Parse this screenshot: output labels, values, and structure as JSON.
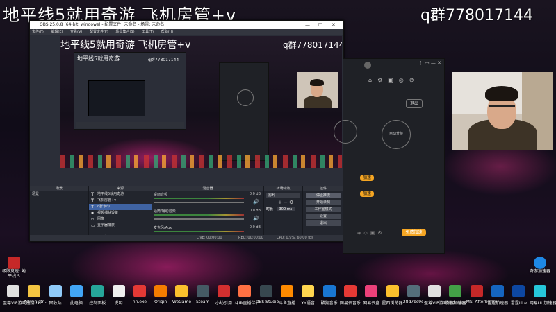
{
  "overlay": {
    "title": "地平线5就用奇游   飞机房管+v",
    "qq": "q群778017144"
  },
  "obs": {
    "window_title": "OBS 25.0.8 (64-bit, windows) - 配置文件: 未命名 - 场景: 未命名",
    "menu": [
      "文件(F)",
      "编辑(E)",
      "查看(V)",
      "配置文件(P)",
      "场景集合(S)",
      "工具(T)",
      "帮助(H)"
    ],
    "preview_title": "地平线5就用奇游   飞机房管+v",
    "preview_qq": "q群778017144",
    "nested_qq": "q群778017144",
    "nested_title": "地平线5就用奇游",
    "docks": {
      "scenes_header": "场景",
      "scene_item": "场景",
      "sources_header": "来源",
      "sources": [
        {
          "label": "地平线5就用奇游",
          "selected": false
        },
        {
          "label": "飞机房管+v",
          "selected": false
        },
        {
          "label": "q群水印",
          "selected": true
        },
        {
          "label": "视频捕获设备",
          "selected": false
        },
        {
          "label": "图像",
          "selected": false
        },
        {
          "label": "显示器捕获",
          "selected": false
        }
      ],
      "mixer_header": "混音器",
      "mixer": [
        {
          "label": "桌面音频",
          "db": "0.0 dB"
        },
        {
          "label": "话筒/辅助音频",
          "db": "0.0 dB"
        },
        {
          "label": "麦克风/Aux",
          "db": "0.0 dB"
        }
      ],
      "transitions_header": "转场特效",
      "transition_value": "淡出",
      "duration_label": "时长",
      "duration_value": "300 ms",
      "controls_header": "控件",
      "controls": [
        "停止推流",
        "开始录制",
        "工作室模式",
        "设置",
        "退出"
      ]
    },
    "status": {
      "live": "LIVE: 00:00:00",
      "rec": "REC: 00:00:00",
      "cpu": "CPU: 0.9%, 60.00 fps"
    }
  },
  "qiyou": {
    "btn_exit": "退出",
    "auto_upgrade": "自动升级",
    "btn_speed": "加速",
    "btn_speed2": "加速",
    "btn_main": "免费加速"
  },
  "desktop_icons": [
    {
      "label": "极限竞速: 地平线 5",
      "color": "#c62828"
    },
    {
      "label": "奇游加速器",
      "color": "#1e88e5"
    }
  ],
  "taskbar": [
    {
      "label": "至尊VIP游戏链接.txt",
      "color": "#e0e0e0"
    },
    {
      "label": "Administr...",
      "color": "#f4c542"
    },
    {
      "label": "回收站",
      "color": "#90caf9"
    },
    {
      "label": "此电脑",
      "color": "#42a5f5"
    },
    {
      "label": "控制面板",
      "color": "#26a69a"
    },
    {
      "label": "说明",
      "color": "#eeeeee"
    },
    {
      "label": "nn.exe",
      "color": "#e53935"
    },
    {
      "label": "Origin",
      "color": "#f57c00"
    },
    {
      "label": "WeGame",
      "color": "#fbc02d"
    },
    {
      "label": "Steam",
      "color": "#455a64"
    },
    {
      "label": "小幼引用",
      "color": "#d32f2f"
    },
    {
      "label": "斗鱼直播伴侣",
      "color": "#ff7043"
    },
    {
      "label": "OBS Studio",
      "color": "#37474f"
    },
    {
      "label": "斗鱼直播",
      "color": "#ff8a00"
    },
    {
      "label": "YY语音",
      "color": "#ffd54f"
    },
    {
      "label": "酷狗音乐",
      "color": "#1976d2"
    },
    {
      "label": "网易云音乐",
      "color": "#e53935"
    },
    {
      "label": "网易云盘",
      "color": "#ec407a"
    },
    {
      "label": "星西浏览器",
      "color": "#fbc02d"
    },
    {
      "label": "28d7bc9c...",
      "color": "#546e7a"
    },
    {
      "label": "至尊VIP游戏链接.txt",
      "color": "#e0e0e0"
    },
    {
      "label": "奇游加速器",
      "color": "#43a047"
    },
    {
      "label": "MSI Afterburner",
      "color": "#c62828"
    },
    {
      "label": "雷霆加速器",
      "color": "#1565c0"
    },
    {
      "label": "雷霆Lite",
      "color": "#0d47a1"
    },
    {
      "label": "网易UU加速器",
      "color": "#26c6da"
    }
  ]
}
